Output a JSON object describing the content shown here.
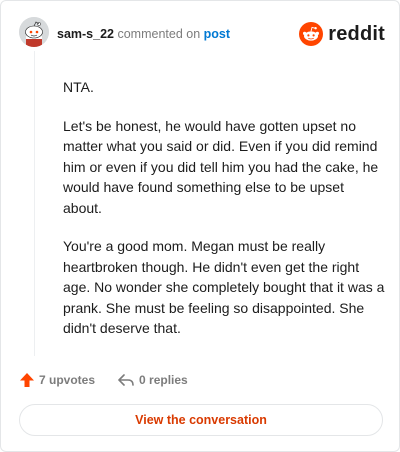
{
  "comment": {
    "username": "sam-s_22",
    "action_text": "commented on",
    "post_link": "post",
    "paragraphs": [
      "NTA.",
      "Let's be honest, he would have gotten upset no matter what you said or did. Even if you did remind him or even if you did tell him you had the cake, he would have found something else to be upset about.",
      "You're a good mom. Megan must be really heartbroken though. He didn't even get the right age. No wonder she completely bought that it was a prank. She must be feeling so disappointed. She didn't deserve that."
    ]
  },
  "logo": {
    "wordmark": "reddit",
    "icon": "reddit-snoo-icon",
    "color": "#ff4500"
  },
  "actions": {
    "upvotes": "7 upvotes",
    "replies": "0 replies",
    "upvote_color": "#ff4500"
  },
  "view_button": {
    "label": "View the conversation",
    "color": "#d93a00"
  }
}
